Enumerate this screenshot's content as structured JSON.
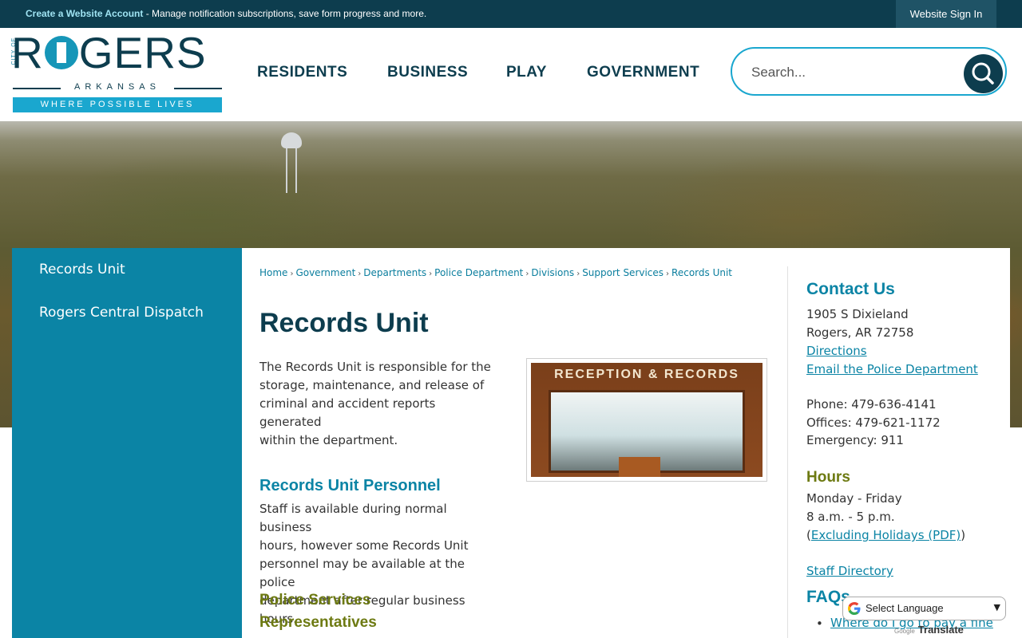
{
  "topbar": {
    "create_account_link": "Create a Website Account",
    "create_account_text": " - Manage notification subscriptions, save form progress and more.",
    "sign_in": "Website Sign In"
  },
  "logo": {
    "city_of": "CITY OF",
    "name_r": "R",
    "name_rest": "GERS",
    "state": "ARKANSAS",
    "tagline": "WHERE POSSIBLE LIVES"
  },
  "nav": {
    "residents": "RESIDENTS",
    "business": "BUSINESS",
    "play": "PLAY",
    "government": "GOVERNMENT"
  },
  "search": {
    "placeholder": "Search..."
  },
  "sidebar": {
    "items": [
      {
        "label": "Records Unit"
      },
      {
        "label": "Rogers Central Dispatch"
      }
    ]
  },
  "breadcrumb": [
    "Home",
    "Government",
    "Departments",
    "Police Department",
    "Divisions",
    "Support Services",
    "Records Unit"
  ],
  "breadcrumb_separator": "›",
  "page": {
    "title": "Records Unit",
    "intro_lines": [
      "The Records Unit is responsible for the",
      "storage, maintenance, and release of",
      "criminal and accident reports generated",
      "within the department."
    ],
    "personnel_heading": "Records Unit Personnel",
    "personnel_lines": [
      "Staff is available during normal business",
      "hours, however some Records Unit",
      "personnel may be available at the police",
      "department after regular business hours."
    ],
    "reps_heading_1": "Police Services",
    "reps_heading_2": "Representatives",
    "photo_sign": "RECEPTION & RECORDS"
  },
  "contact": {
    "heading": "Contact Us",
    "address_1": "1905 S Dixieland",
    "address_2": "Rogers, AR 72758",
    "directions": "Directions",
    "email": "Email the Police Department",
    "phone": "Phone: 479-636-4141",
    "offices": "Offices: 479-621-1172",
    "emergency": "Emergency: 911",
    "hours_heading": "Hours",
    "hours_days": "Monday - Friday",
    "hours_time": "8 a.m. - 5 p.m.",
    "hours_open": "(",
    "holidays_link": "Excluding Holidays (PDF)",
    "hours_close": ")",
    "staff_directory": "Staff Directory",
    "faqs_heading": "FAQs",
    "faq_1": "Where do I go to pay a fine"
  },
  "translate": {
    "select_label": "Select Language",
    "powered_by_google": "Google",
    "translate_label": "Translate"
  },
  "colors": {
    "topbar": "#0d3d4e",
    "accent_teal": "#0b84a5",
    "heading_dark": "#0d3d4e",
    "olive_heading": "#6d7a12"
  }
}
